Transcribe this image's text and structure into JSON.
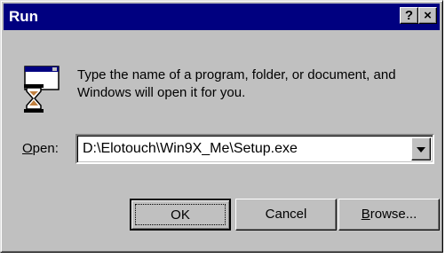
{
  "window": {
    "title": "Run",
    "help_label": "?",
    "close_label": "×"
  },
  "prompt": {
    "description": "Type the name of a program, folder, or document, and Windows will open it for you.",
    "icon": "run-hourglass-window-icon"
  },
  "open_field": {
    "label_first": "O",
    "label_rest": "pen:",
    "value": "D:\\Elotouch\\Win9X_Me\\Setup.exe",
    "dropdown_icon": "chevron-down-icon"
  },
  "buttons": {
    "ok": "OK",
    "cancel": "Cancel",
    "browse_first": "B",
    "browse_rest": "rowse..."
  },
  "colors": {
    "titlebar": "#000080",
    "face": "#c0c0c0"
  }
}
